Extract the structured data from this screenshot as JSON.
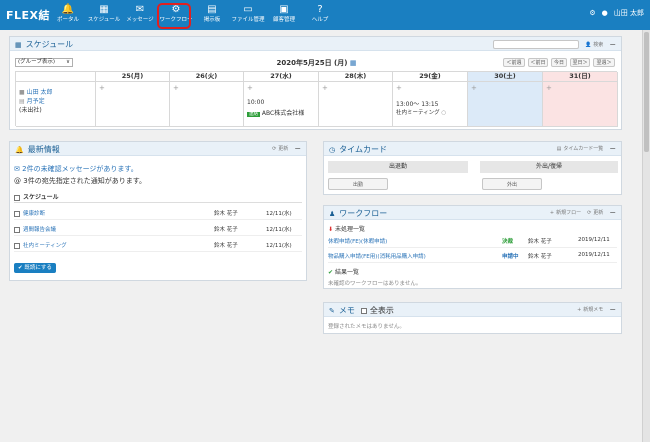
{
  "header": {
    "logo": "FLEX結",
    "nav": [
      {
        "icon": "bell-icon",
        "glyph": "🔔",
        "label": "ポータル"
      },
      {
        "icon": "calendar-icon",
        "glyph": "▦",
        "label": "スケジュール"
      },
      {
        "icon": "envelope-icon",
        "glyph": "✉",
        "label": "メッセージ"
      },
      {
        "icon": "workflow-icon",
        "glyph": "⚙",
        "label": "ワークフロー"
      },
      {
        "icon": "bulletin-icon",
        "glyph": "▤",
        "label": "掲示板"
      },
      {
        "icon": "file-icon",
        "glyph": "▭",
        "label": "ファイル管理"
      },
      {
        "icon": "customer-icon",
        "glyph": "▣",
        "label": "顧客管理"
      },
      {
        "icon": "help-icon",
        "glyph": "?",
        "label": "ヘルプ"
      }
    ],
    "user_name": "山田 太郎"
  },
  "schedule": {
    "title": "スケジュール",
    "search_label": "検索",
    "group_select": "(グループ表示)",
    "date_label": "2020年5月25日 (月)",
    "nav_buttons": [
      "＜前週",
      "＜前日",
      "今日",
      "翌日＞",
      "翌週＞"
    ],
    "days": [
      {
        "label": "25(月)"
      },
      {
        "label": "26(火)"
      },
      {
        "label": "27(水)"
      },
      {
        "label": "28(木)"
      },
      {
        "label": "29(金)"
      },
      {
        "label": "30(土)"
      },
      {
        "label": "31(日)"
      }
    ],
    "user": {
      "name": "山田 太郎",
      "tag": "月予定",
      "status": "(未出社)"
    },
    "events": {
      "wed_time": "10:00",
      "wed_badge": "連絡",
      "wed_title": "ABC株式会社様",
      "fri_time": "13:00～ 13:15",
      "fri_title": "社内ミーティング"
    }
  },
  "news": {
    "title": "最新情報",
    "refresh": "更新",
    "unread_msg": "2件の未確認メッセージがあります。",
    "notice_msg": "3件の宛先指定された通知があります。",
    "section_label": "スケジュール",
    "items": [
      {
        "title": "健康診断",
        "person": "鈴木 花子",
        "date": "12/11(水)"
      },
      {
        "title": "週間報告会議",
        "person": "鈴木 花子",
        "date": "12/11(水)"
      },
      {
        "title": "社内ミーティング",
        "person": "鈴木 花子",
        "date": "12/11(水)"
      }
    ],
    "confirm_button": "既読にする"
  },
  "timecard": {
    "title": "タイムカード",
    "list_link": "タイムカード一覧",
    "header_in": "出退勤",
    "header_out": "外出/復帰",
    "btn_in": "出勤",
    "btn_out": "外出"
  },
  "workflow": {
    "title": "ワークフロー",
    "new_link": "新規フロー",
    "refresh": "更新",
    "pending_label": "未処理一覧",
    "items": [
      {
        "title": "休暇申請(FE)(休暇申請)",
        "status": "決裁",
        "status_color": "#2e9e3a",
        "person": "鈴木 花子",
        "date": "2019/12/11"
      },
      {
        "title": "物品購入申請(FE用)(消耗用品購入申請)",
        "status": "申請中",
        "status_color": "#2b74b8",
        "person": "鈴木 花子",
        "date": "2019/12/11"
      }
    ],
    "result_label": "結果一覧",
    "empty_msg": "未確認のワークフローはありません。"
  },
  "memo": {
    "title": "メモ",
    "show_all": "全表示",
    "new_link": "新規メモ",
    "empty_msg": "登録されたメモはありません。"
  },
  "colors": {
    "brand": "#1a7fc1",
    "saturday": "#dceaf8",
    "sunday": "#fbe3e3"
  }
}
